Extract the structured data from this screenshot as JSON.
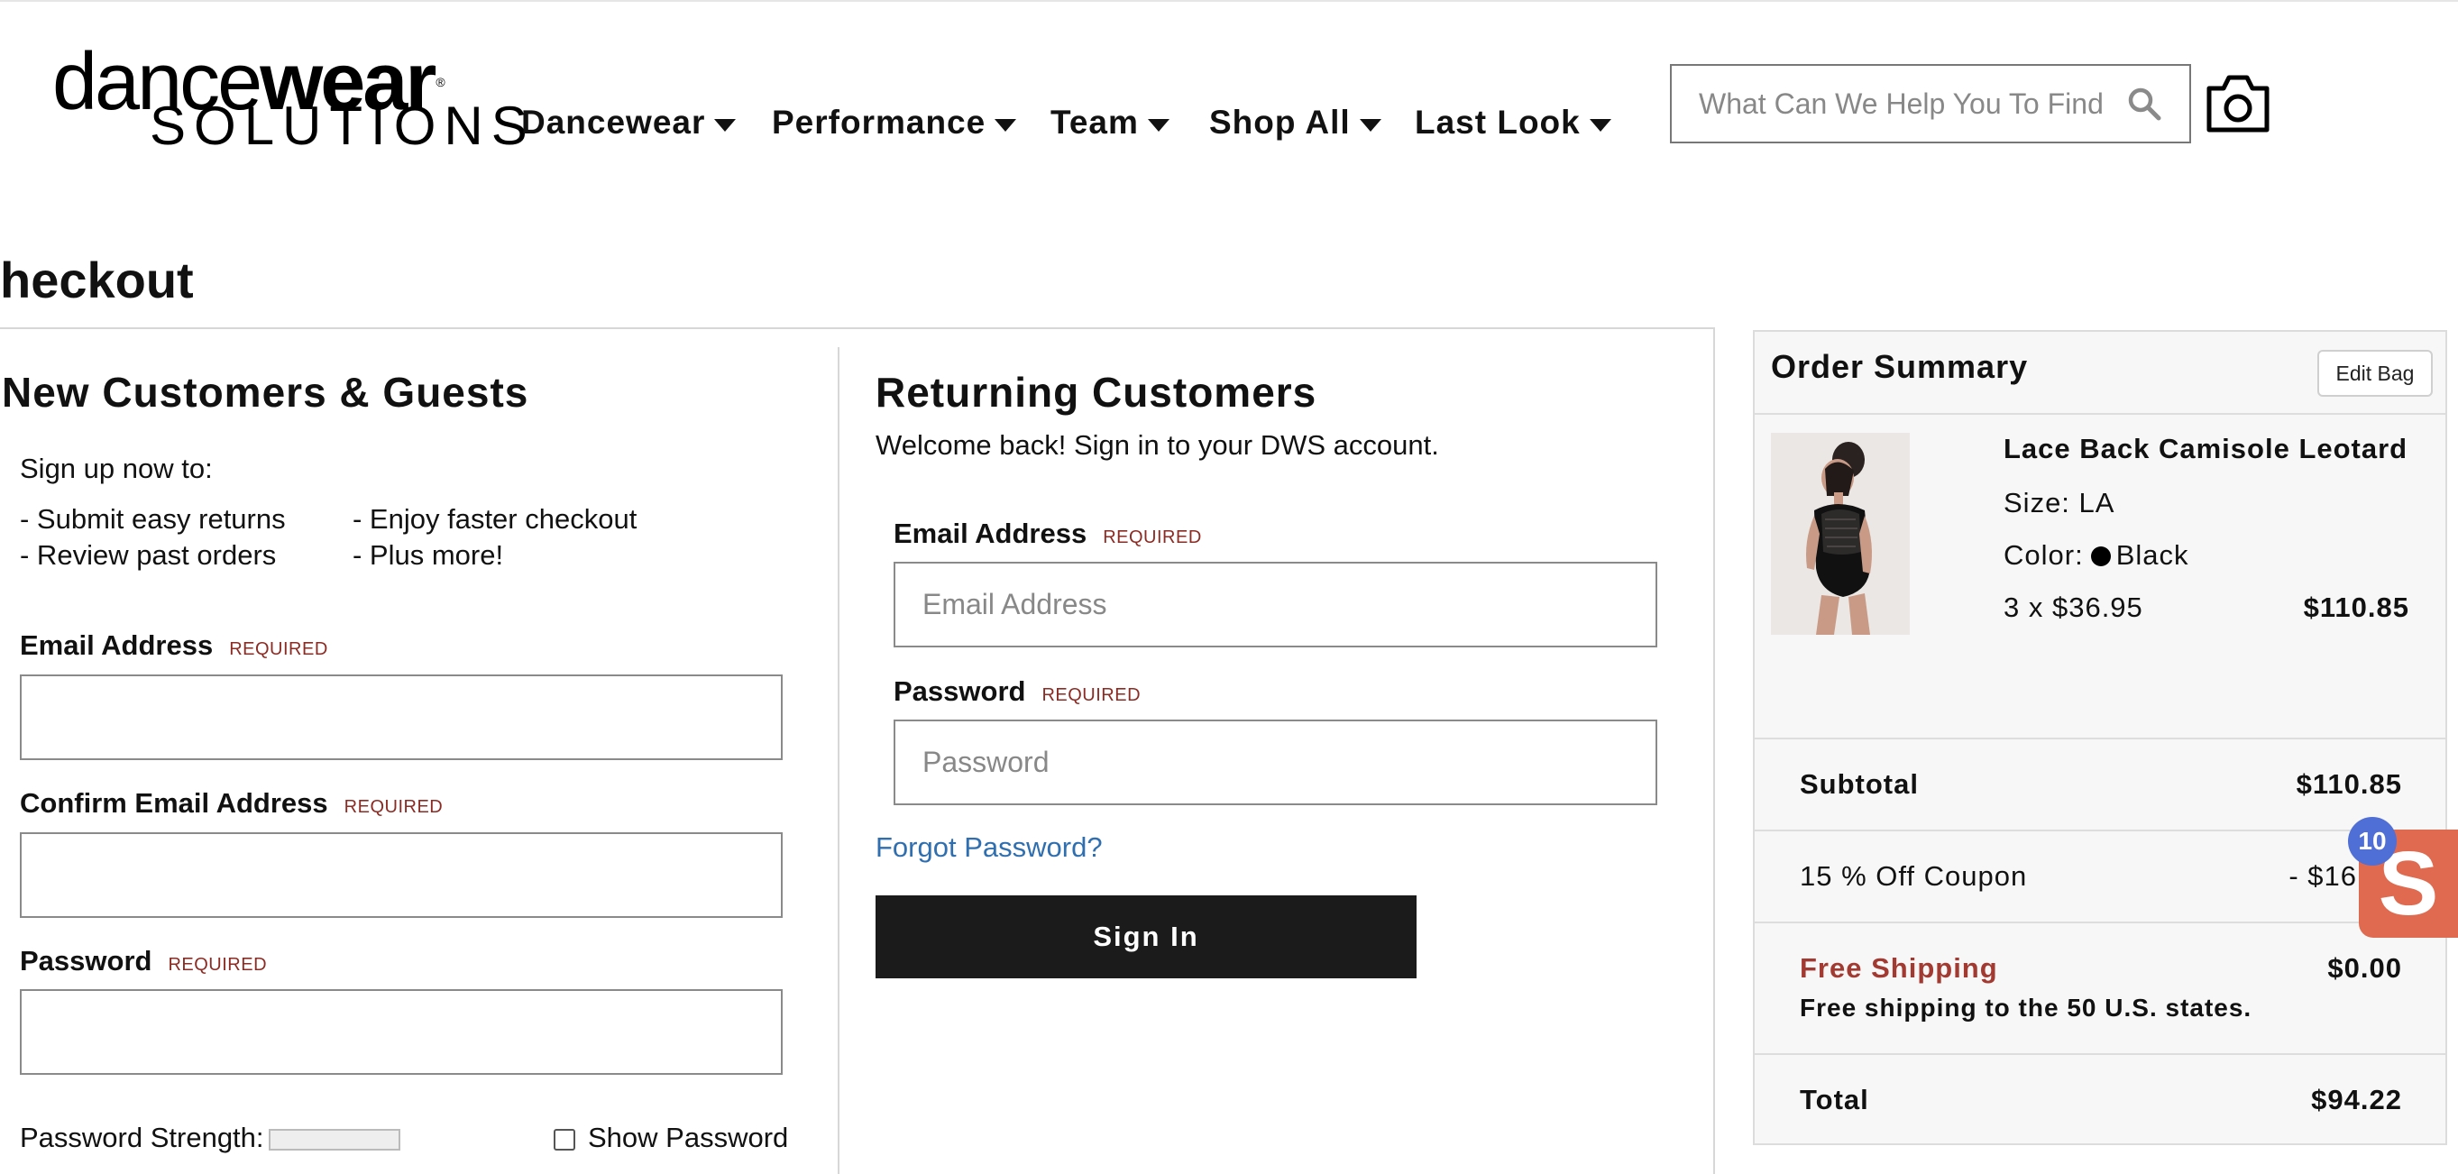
{
  "brand": {
    "logo_top_light": "dance",
    "logo_top_bold": "wear",
    "logo_registered": "®",
    "logo_bottom": "SOLUTIONS"
  },
  "nav": {
    "items": [
      {
        "label": "Dancewear"
      },
      {
        "label": "Performance"
      },
      {
        "label": "Team"
      },
      {
        "label": "Shop All"
      },
      {
        "label": "Last Look"
      }
    ]
  },
  "search": {
    "placeholder": "What Can We Help You To Find",
    "value": ""
  },
  "page": {
    "title": "heckout"
  },
  "new_customers": {
    "heading": "New Customers & Guests",
    "signup_intro": "Sign up now to:",
    "benefits": [
      "- Submit easy returns",
      "- Enjoy faster checkout",
      "- Review past orders",
      "- Plus more!"
    ],
    "email_label": "Email Address",
    "confirm_email_label": "Confirm Email Address",
    "password_label": "Password",
    "required_tag": "REQUIRED",
    "strength_label": "Password Strength:",
    "show_password_label": "Show Password",
    "strength_level": 0
  },
  "returning": {
    "heading": "Returning Customers",
    "welcome": "Welcome back!  Sign in to your DWS account.",
    "email_label": "Email Address",
    "email_placeholder": "Email Address",
    "password_label": "Password",
    "password_placeholder": "Password",
    "required_tag": "REQUIRED",
    "forgot": "Forgot Password?",
    "signin": "Sign In"
  },
  "summary": {
    "title": "Order Summary",
    "edit_bag": "Edit Bag",
    "product": {
      "name": "Lace Back Camisole Leotard",
      "size": "Size: LA",
      "color_label": "Color:",
      "color_value": "Black",
      "qty_price": "3 x $36.95",
      "line_total": "$110.85"
    },
    "subtotal_label": "Subtotal",
    "subtotal_value": "$110.85",
    "coupon_label": "15 % Off Coupon",
    "coupon_value": "- $16",
    "shipping_label": "Free Shipping",
    "shipping_value": "$0.00",
    "shipping_note": "Free shipping to the 50 U.S. states.",
    "total_label": "Total",
    "total_value": "$94.22"
  },
  "floater": {
    "letter": "S",
    "count": "10"
  },
  "colors": {
    "accent_link": "#2f6fb0",
    "required": "#8b2b23",
    "shipping": "#a23a32",
    "button_bg": "#1b1b1b",
    "floater": "#e06a4f",
    "badge": "#4f6fd6"
  }
}
